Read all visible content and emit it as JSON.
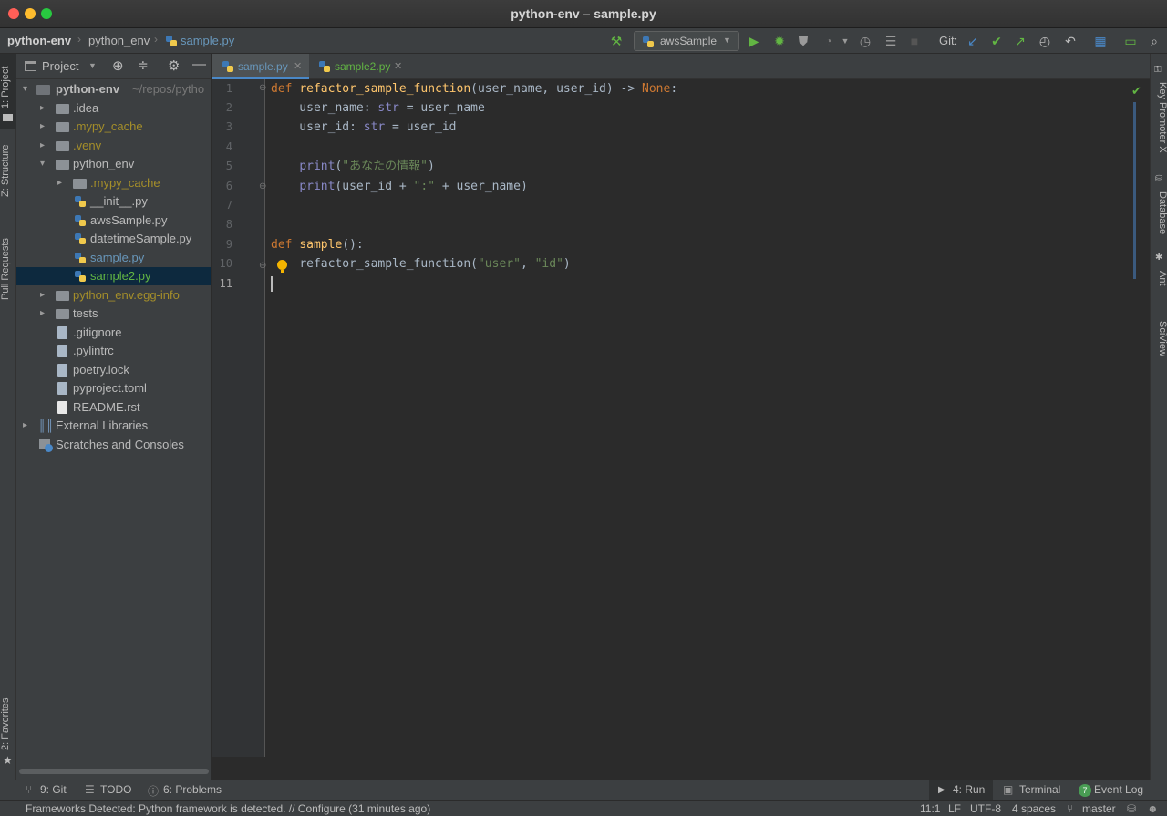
{
  "window": {
    "title": "python-env – sample.py"
  },
  "navbar": {
    "crumbs": [
      "python-env",
      "python_env",
      "sample.py"
    ],
    "run_config": "awsSample",
    "git_label": "Git:"
  },
  "left_stripe": {
    "project": "1: Project",
    "structure": "Z: Structure",
    "pull_requests": "Pull Requests",
    "favorites": "2: Favorites"
  },
  "project_panel": {
    "title": "Project",
    "root": {
      "name": "python-env",
      "path": "~/repos/pytho"
    },
    "items": [
      {
        "name": ".idea"
      },
      {
        "name": ".mypy_cache"
      },
      {
        "name": ".venv"
      },
      {
        "name": "python_env"
      },
      {
        "name": ".mypy_cache"
      },
      {
        "name": "__init__.py"
      },
      {
        "name": "awsSample.py"
      },
      {
        "name": "datetimeSample.py"
      },
      {
        "name": "sample.py"
      },
      {
        "name": "sample2.py"
      },
      {
        "name": "python_env.egg-info"
      },
      {
        "name": "tests"
      },
      {
        "name": ".gitignore"
      },
      {
        "name": ".pylintrc"
      },
      {
        "name": "poetry.lock"
      },
      {
        "name": "pyproject.toml"
      },
      {
        "name": "README.rst"
      },
      {
        "name": "External Libraries"
      },
      {
        "name": "Scratches and Consoles"
      }
    ]
  },
  "editor": {
    "tabs": [
      {
        "label": "sample.py"
      },
      {
        "label": "sample2.py"
      }
    ],
    "line_numbers": [
      "1",
      "2",
      "3",
      "4",
      "5",
      "6",
      "7",
      "8",
      "9",
      "10",
      "11"
    ],
    "code": {
      "l1_def": "def",
      "l1_fn": "refactor_sample_function",
      "l1_params": "(user_name, user_id) -> ",
      "l1_none": "None",
      "l1_colon": ":",
      "l2_a": "    user_name: ",
      "l2_type": "str",
      "l2_b": " = user_name",
      "l3_a": "    user_id: ",
      "l3_type": "str",
      "l3_b": " = user_id",
      "l5_print": "print",
      "l5_open": "(",
      "l5_str": "\"あなたの情報\"",
      "l5_close": ")",
      "l6_print": "print",
      "l6_a": "(user_id + ",
      "l6_str": "\":\"",
      "l6_b": " + user_name)",
      "l9_def": "def",
      "l9_fn": "sample",
      "l9_rest": "():",
      "l10_call": "refactor_sample_function(",
      "l10_s1": "\"user\"",
      "l10_comma": ", ",
      "l10_s2": "\"id\"",
      "l10_close": ")"
    }
  },
  "right_stripe": {
    "key_promoter": "Key Promoter X",
    "database": "Database",
    "ant": "Ant",
    "sciview": "SciView"
  },
  "bottom_tools": {
    "git": "9: Git",
    "todo": "TODO",
    "problems": "6: Problems",
    "run": "4: Run",
    "terminal": "Terminal",
    "event_log": "Event Log",
    "event_count": "7"
  },
  "status": {
    "message": "Frameworks Detected: Python framework is detected. // Configure (31 minutes ago)",
    "position": "11:1",
    "line_sep": "LF",
    "encoding": "UTF-8",
    "indent": "4 spaces",
    "branch": "master"
  },
  "colors": {
    "keyword": "#cc7832",
    "function": "#ffc66d",
    "string": "#6a8759",
    "builtin": "#8888c6",
    "accent_blue": "#4a88c7",
    "git_green": "#62b543"
  }
}
